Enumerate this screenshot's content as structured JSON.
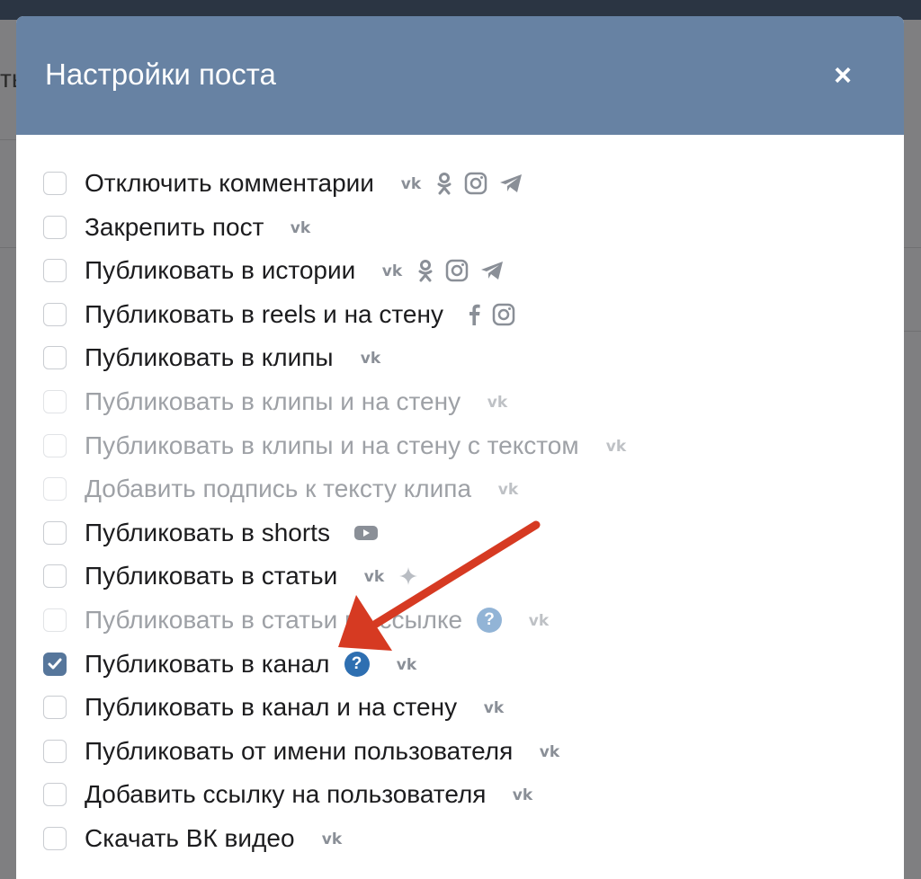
{
  "background": {
    "fragment": "ть"
  },
  "modal": {
    "title": "Настройки поста",
    "close_label": "×",
    "header_color": "#6782a3"
  },
  "options": [
    {
      "label": "Отключить комментарии",
      "checked": false,
      "disabled": false,
      "icons": [
        "vk-icon",
        "ok-icon",
        "instagram-icon",
        "telegram-icon"
      ]
    },
    {
      "label": "Закрепить пост",
      "checked": false,
      "disabled": false,
      "icons": [
        "vk-icon"
      ]
    },
    {
      "label": "Публиковать в истории",
      "checked": false,
      "disabled": false,
      "icons": [
        "vk-icon",
        "ok-icon",
        "instagram-icon",
        "telegram-icon"
      ]
    },
    {
      "label": "Публиковать в reels и на стену",
      "checked": false,
      "disabled": false,
      "icons": [
        "facebook-icon",
        "instagram-icon"
      ]
    },
    {
      "label": "Публиковать в клипы",
      "checked": false,
      "disabled": false,
      "icons": [
        "vk-icon"
      ]
    },
    {
      "label": "Публиковать в клипы и на стену",
      "checked": false,
      "disabled": true,
      "icons": [
        "vk-icon"
      ]
    },
    {
      "label": "Публиковать в клипы и на стену с текстом",
      "checked": false,
      "disabled": true,
      "icons": [
        "vk-icon"
      ]
    },
    {
      "label": "Добавить подпись к тексту клипа",
      "checked": false,
      "disabled": true,
      "icons": [
        "vk-icon"
      ]
    },
    {
      "label": "Публиковать в shorts",
      "checked": false,
      "disabled": false,
      "icons": [
        "youtube-icon"
      ]
    },
    {
      "label": "Публиковать в статьи",
      "checked": false,
      "disabled": false,
      "icons": [
        "vk-icon",
        "sparkle-icon"
      ]
    },
    {
      "label": "Публиковать в статьи по ссылке",
      "checked": false,
      "disabled": true,
      "help": "?",
      "icons": [
        "vk-icon"
      ]
    },
    {
      "label": "Публиковать в канал",
      "checked": true,
      "disabled": false,
      "help": "?",
      "icons": [
        "vk-icon"
      ]
    },
    {
      "label": "Публиковать в канал и на стену",
      "checked": false,
      "disabled": false,
      "icons": [
        "vk-icon"
      ]
    },
    {
      "label": "Публиковать от имени пользователя",
      "checked": false,
      "disabled": false,
      "icons": [
        "vk-icon"
      ]
    },
    {
      "label": "Добавить ссылку на пользователя",
      "checked": false,
      "disabled": false,
      "icons": [
        "vk-icon"
      ]
    },
    {
      "label": "Скачать ВК видео",
      "checked": false,
      "disabled": false,
      "icons": [
        "vk-icon"
      ]
    }
  ],
  "annotation": {
    "arrow_color": "#d63a22"
  }
}
